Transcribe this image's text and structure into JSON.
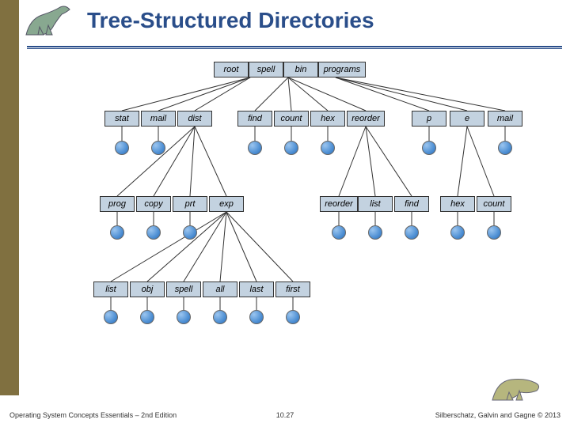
{
  "title": "Tree-Structured Directories",
  "footer": {
    "left": "Operating System Concepts Essentials – 2nd Edition",
    "mid": "10.27",
    "right": "Silberschatz, Galvin and Gagne © 2013"
  },
  "level0": {
    "root": "root",
    "spell": "spell",
    "bin": "bin",
    "programs": "programs"
  },
  "level1": {
    "stat": "stat",
    "mail": "mail",
    "dist": "dist",
    "find": "find",
    "count": "count",
    "hex": "hex",
    "reorder": "reorder",
    "p": "p",
    "e": "e",
    "mail2": "mail"
  },
  "level2a": {
    "prog": "prog",
    "copy": "copy",
    "prt": "prt",
    "exp": "exp"
  },
  "level2b": {
    "reorder": "reorder",
    "list": "list",
    "find": "find",
    "hex": "hex",
    "count": "count"
  },
  "level3": {
    "list": "list",
    "obj": "obj",
    "spell": "spell",
    "all": "all",
    "last": "last",
    "first": "first"
  }
}
